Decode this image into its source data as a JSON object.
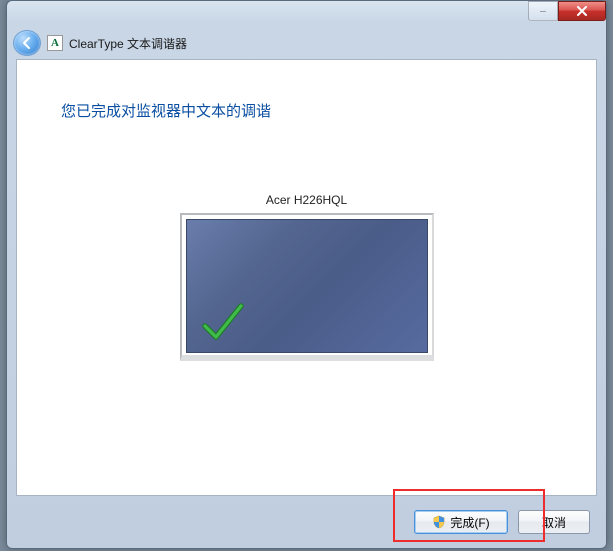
{
  "header": {
    "title": "ClearType 文本调谐器"
  },
  "main": {
    "heading": "您已完成对监视器中文本的调谐",
    "monitor_name": "Acer H226HQL"
  },
  "footer": {
    "finish_label": "完成(F)",
    "cancel_label": "取消"
  }
}
